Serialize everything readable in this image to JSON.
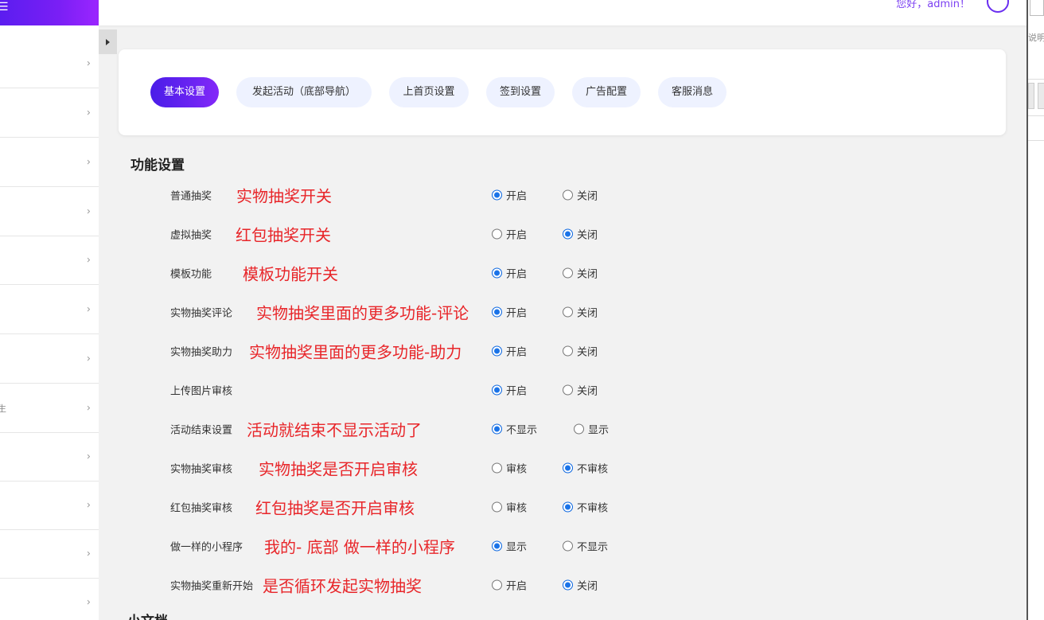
{
  "header": {
    "greeting": "您好，admin！"
  },
  "sidebar": {
    "menu_icon": "menu-icon",
    "item_fragment": "生",
    "chevron": "›"
  },
  "tabs": [
    {
      "label": "基本设置",
      "active": true
    },
    {
      "label": "发起活动（底部导航）",
      "active": false
    },
    {
      "label": "上首页设置",
      "active": false
    },
    {
      "label": "签到设置",
      "active": false
    },
    {
      "label": "广告配置",
      "active": false
    },
    {
      "label": "客服消息",
      "active": false
    }
  ],
  "section": {
    "title": "功能设置",
    "rows": [
      {
        "label": "普通抽奖",
        "note": "实物抽奖开关",
        "options": [
          "开启",
          "关闭"
        ],
        "selected": 0
      },
      {
        "label": "虚拟抽奖",
        "note": "红包抽奖开关",
        "options": [
          "开启",
          "关闭"
        ],
        "selected": 1
      },
      {
        "label": "模板功能",
        "note": "模板功能开关",
        "options": [
          "开启",
          "关闭"
        ],
        "selected": 0
      },
      {
        "label": "实物抽奖评论",
        "note": "实物抽奖里面的更多功能-评论",
        "options": [
          "开启",
          "关闭"
        ],
        "selected": 0
      },
      {
        "label": "实物抽奖助力",
        "note": "实物抽奖里面的更多功能-助力",
        "options": [
          "开启",
          "关闭"
        ],
        "selected": 0
      },
      {
        "label": "上传图片审核",
        "note": "",
        "options": [
          "开启",
          "关闭"
        ],
        "selected": 0
      },
      {
        "label": "活动结束设置",
        "note": "活动就结束不显示活动了",
        "options": [
          "不显示",
          "显示"
        ],
        "selected": 0
      },
      {
        "label": "实物抽奖审核",
        "note": "实物抽奖是否开启审核",
        "options": [
          "审核",
          "不审核"
        ],
        "selected": 1
      },
      {
        "label": "红包抽奖审核",
        "note": "红包抽奖是否开启审核",
        "options": [
          "审核",
          "不审核"
        ],
        "selected": 1
      },
      {
        "label": "做一样的小程序",
        "note": "我的- 底部 做一样的小程序",
        "options": [
          "显示",
          "不显示"
        ],
        "selected": 0
      },
      {
        "label": "实物抽奖重新开始",
        "note": "是否循环发起实物抽奖",
        "options": [
          "开启",
          "关闭"
        ],
        "selected": 1
      }
    ]
  },
  "next_section": {
    "title": "小文档"
  },
  "right_window": {
    "fragment": "说明"
  },
  "colors": {
    "accent": "#5b1df0",
    "note": "#e8262a",
    "radio": "#1a73e8",
    "tab_bg": "#eef2ff"
  }
}
